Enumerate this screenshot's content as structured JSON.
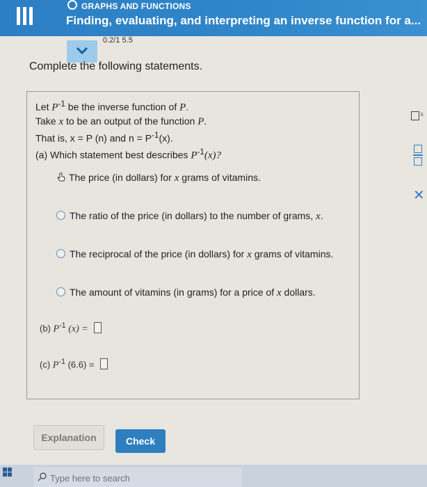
{
  "header": {
    "topic": "GRAPHS AND FUNCTIONS",
    "title": "Finding, evaluating, and interpreting an inverse function for a..."
  },
  "partial_top_text": "0.2/1  5.5",
  "instructions": "Complete the following statements.",
  "intro": {
    "line1_pre": "Let ",
    "line1_fn": "P",
    "line1_sup": "-1",
    "line1_post": " be the inverse function of ",
    "line1_var": "P",
    "line1_end": ".",
    "line2_pre": "Take ",
    "line2_var": "x",
    "line2_post": " to be an output of the function ",
    "line2_fn": "P",
    "line2_end": ".",
    "line3": "That is, x = P (n) and n = P",
    "line3_sup": "-1",
    "line3_end": "(x)."
  },
  "part_a": {
    "label": "(a)  Which statement best describes ",
    "fn": "P",
    "sup": "-1",
    "arg": "(x)?"
  },
  "options": [
    {
      "pre": "The price (in dollars) for ",
      "var": "x",
      "post": " grams of vitamins."
    },
    {
      "pre": "The ratio of the price (in dollars) to the number of grams, ",
      "var": "x",
      "post": "."
    },
    {
      "pre": "The reciprocal of the price (in dollars) for ",
      "var": "x",
      "post": " grams of vitamins."
    },
    {
      "pre": "The amount of vitamins (in grams) for a price of ",
      "var": "x",
      "post": " dollars."
    }
  ],
  "part_b": {
    "label": "(b)  ",
    "fn": "P",
    "sup": "-1",
    "arg": " (x)  =  "
  },
  "part_c": {
    "label": "(c)  ",
    "fn": "P",
    "sup": "-1",
    "arg": " (6.6)  =  "
  },
  "side_tools": {
    "box_label": "k"
  },
  "buttons": {
    "explanation": "Explanation",
    "check": "Check"
  },
  "taskbar": {
    "search_placeholder": "Type here to search"
  },
  "colors": {
    "header_blue": "#2d7fc4",
    "accent_blue": "#3a7cc2",
    "check_button": "#2f7fc0"
  }
}
